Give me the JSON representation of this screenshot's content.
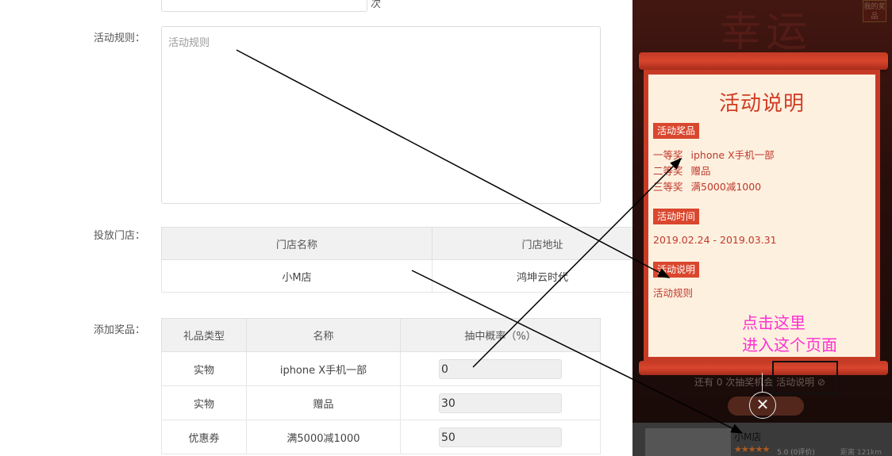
{
  "form": {
    "top_unit": "次",
    "rules_label": "活动规则：",
    "rules_placeholder": "活动规则",
    "store_label": "投放门店：",
    "store_table": {
      "headers": [
        "门店名称",
        "门店地址"
      ],
      "rows": [
        [
          "小M店",
          "鸿坤云时代"
        ]
      ]
    },
    "prize_label": "添加奖品：",
    "prize_table": {
      "headers": [
        "礼品类型",
        "名称",
        "抽中概率（%）"
      ],
      "rows": [
        {
          "type": "实物",
          "name": "iphone X手机一部",
          "prob": "0"
        },
        {
          "type": "实物",
          "name": "赠品",
          "prob": "30"
        },
        {
          "type": "优惠券",
          "name": "满5000减1000",
          "prob": "50"
        }
      ]
    }
  },
  "phone": {
    "bg_title": "幸运",
    "my_prize": "我的奖品",
    "modal_title": "活动说明",
    "prizes_tag": "活动奖品",
    "prizes": [
      {
        "level": "一等奖",
        "name": "iphone X手机一部"
      },
      {
        "level": "二等奖",
        "name": "赠品"
      },
      {
        "level": "三等奖",
        "name": "满5000减1000"
      }
    ],
    "time_tag": "活动时间",
    "time_value": "2019.02.24 - 2019.03.31",
    "desc_tag": "活动说明",
    "desc_value": "活动规则",
    "annotation_line1": "点击这里",
    "annotation_line2": "进入这个页面",
    "strip_text": "还有 0 次抽奖机会   活动说明 ⊘",
    "close_symbol": "✕",
    "store_name": "小M店",
    "stars": "★★★★★",
    "star_score": "5.0 (0评价)",
    "distance": "距离 121km"
  },
  "colors": {
    "scroll_red": "#d9452c",
    "paper_cream": "#fdf0df",
    "prize_text": "#c0392b",
    "annotation_magenta": "#ff30d0"
  }
}
